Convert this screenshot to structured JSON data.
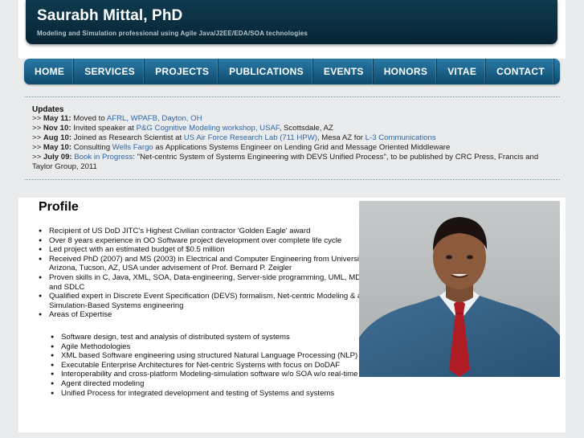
{
  "header": {
    "title": "Saurabh Mittal, PhD",
    "tagline": "Modeling and Simulation professional using Agile Java/J2EE/EDA/SOA technologies"
  },
  "nav": {
    "items": [
      "HOME",
      "SERVICES",
      "PROJECTS",
      "PUBLICATIONS",
      "EVENTS",
      "HONORS",
      "VITAE",
      "CONTACT"
    ]
  },
  "updates": {
    "title": "Updates",
    "items": [
      {
        "prefix": ">> ",
        "date": "May 11:",
        "pre": " Moved to ",
        "link": "AFRL, WPAFB, Dayton, OH",
        "post": ""
      },
      {
        "prefix": ">> ",
        "date": "Nov 10:",
        "pre": " Invited speaker at ",
        "link": "P&G Cognitive Modeling workshop, USAF",
        "post": ", Scottsdale, AZ"
      },
      {
        "prefix": ">> ",
        "date": "Aug 10:",
        "pre": " Joined as Research Scientist at ",
        "link": "US Air Force Research Lab (711 HPW)",
        "post": ", Mesa AZ for ",
        "link2": "L-3 Communications"
      },
      {
        "prefix": ">> ",
        "date": "May 10:",
        "pre": " Consulting ",
        "link": "Wells Fargo",
        "post": " as Applications Systems Engineer on Lending Grid and Message Oriented Middleware"
      },
      {
        "prefix": ">> ",
        "date": "July 09:",
        "pre": " ",
        "link": "Book in Progress",
        "post": ": \"Net-centric System of Systems Engineering with DEVS Unified Process\", to be published by CRC Press, Francis and Taylor Group, 2011"
      }
    ]
  },
  "profile": {
    "title": "Profile",
    "highlights": [
      "Recipient of US DoD JITC's Highest Civilian contractor 'Golden Eagle' award",
      "Over 8 years experience in OO Software project development over complete life cycle",
      "Led project with an estimated budget of $0.5 million",
      "Received PhD (2007) and MS (2003) in Electrical and Computer Engineering from University of Arizona, Tucson, AZ, USA under advisement of Prof. Bernard P. Zeigler",
      "Proven skills in C, Java, XML, SOA, Data-engineering, Server-side programming, UML, MDA and SDLC",
      "Qualified expert in Discrete Event Specification (DEVS) formalism, Net-centric Modeling & and Simulation-Based Systems engineering",
      "Areas of Expertise"
    ],
    "expertise": [
      "Software design, test and analysis of distributed system of systems",
      "Agile Methodologies",
      "XML based Software engineering  using structured Natural Language Processing (NLP)",
      "Executable Enterprise Architectures for Net-centric Systems with focus on DoDAF",
      "Interoperability and cross-platform Modeling-simulation software w/o SOA w/o real-time execution",
      "Agent directed modeling",
      "Unified Process for integrated development and testing of Systems and systems"
    ]
  },
  "colors": {
    "header_bg": "#0a2f42",
    "nav_bg": "#1a6590",
    "link": "#2f66a8",
    "page_bg": "#e9ebec"
  }
}
